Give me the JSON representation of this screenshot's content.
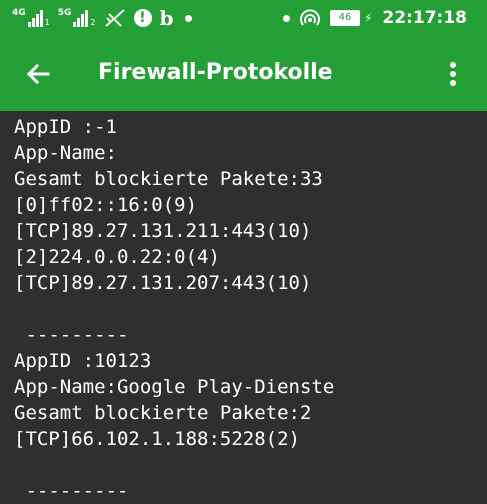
{
  "status_bar": {
    "sig1_label": "4G",
    "sig1_num": "1",
    "sig2_label": "5G",
    "sig2_num": "2",
    "battery": "46",
    "time": "22:17:18",
    "alert_symbol": "!",
    "b_letter": "b"
  },
  "app_bar": {
    "title": "Firewall-Protokolle"
  },
  "log": {
    "entries": [
      {
        "appid": "AppID :-1",
        "appname": "App-Name:",
        "total": "Gesamt blockierte Pakete:33",
        "lines": [
          "[0]ff02::16:0(9)",
          "[TCP]89.27.131.211:443(10)",
          "[2]224.0.0.22:0(4)",
          "[TCP]89.27.131.207:443(10)"
        ]
      },
      {
        "appid": "AppID :10123",
        "appname": "App-Name:Google Play-Dienste",
        "total": "Gesamt blockierte Pakete:2",
        "lines": [
          "[TCP]66.102.1.188:5228(2)"
        ]
      }
    ],
    "separator": " ---------"
  },
  "colors": {
    "primary": "#239f35",
    "background": "#2f2f2f",
    "text": "#ffffff"
  }
}
